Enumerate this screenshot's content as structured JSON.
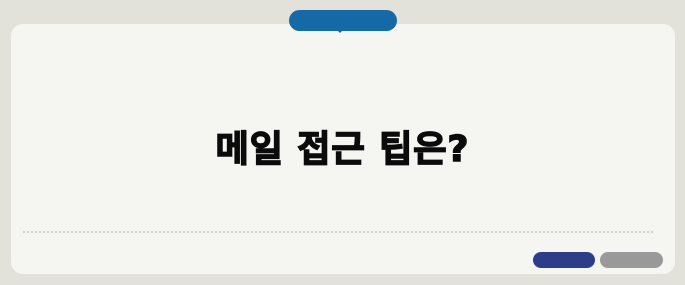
{
  "headline": "메일 접근 팁은?",
  "faint_label": "",
  "colors": {
    "page_background": "#e3e2da",
    "card_background": "#f5f5f2",
    "top_pill": "#1569a7",
    "primary_button": "#2e3d8a",
    "secondary_button": "#999999"
  }
}
